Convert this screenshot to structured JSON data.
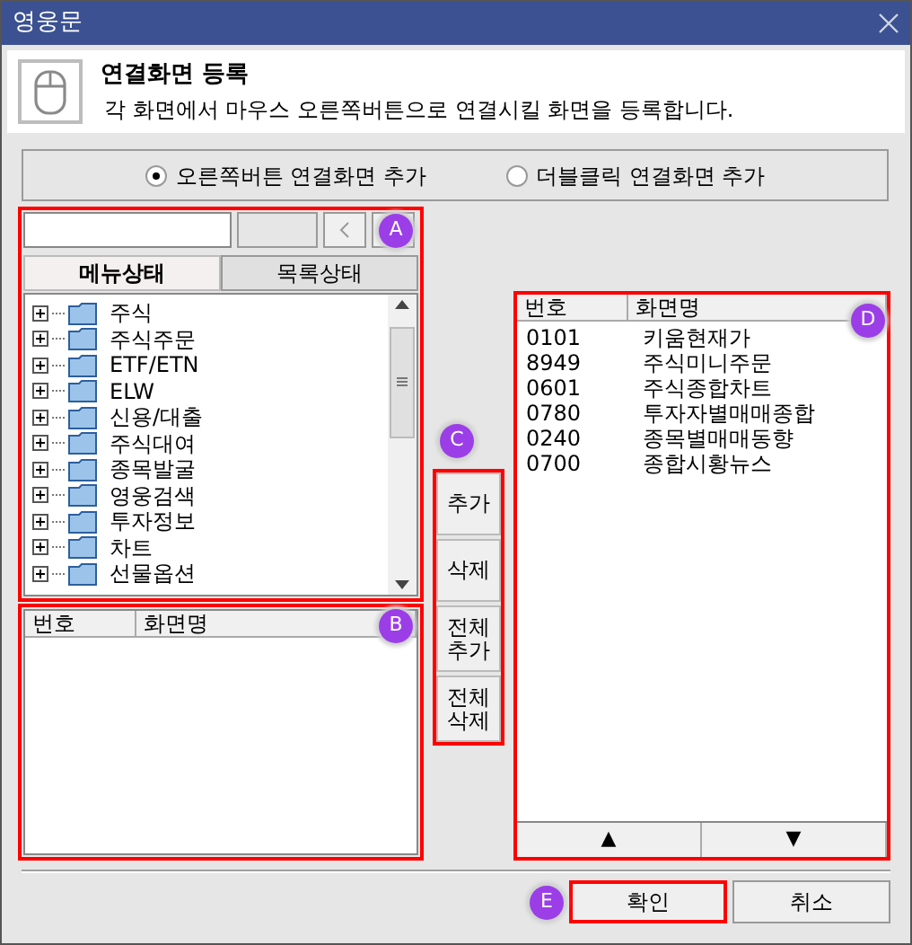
{
  "window": {
    "title": "영웅문"
  },
  "header": {
    "title": "연결화면 등록",
    "description": "각 화면에서 마우스 오른쪽버튼으로 연결시킬 화면을 등록합니다."
  },
  "radio_options": [
    {
      "label": "오른쪽버튼 연결화면 추가",
      "selected": true
    },
    {
      "label": "더블클릭 연결화면 추가",
      "selected": false
    }
  ],
  "tabs": [
    {
      "label": "메뉴상태",
      "selected": true
    },
    {
      "label": "목록상태",
      "selected": false
    }
  ],
  "tree": {
    "items": [
      {
        "label": "주식",
        "expanded": false
      },
      {
        "label": "주식주문",
        "expanded": false
      },
      {
        "label": "ETF/ETN",
        "expanded": false
      },
      {
        "label": "ELW",
        "expanded": false
      },
      {
        "label": "신용/대출",
        "expanded": false
      },
      {
        "label": "주식대여",
        "expanded": false
      },
      {
        "label": "종목발굴",
        "expanded": false
      },
      {
        "label": "영웅검색",
        "expanded": false
      },
      {
        "label": "투자정보",
        "expanded": false
      },
      {
        "label": "차트",
        "expanded": false
      },
      {
        "label": "선물옵션",
        "expanded": false
      }
    ]
  },
  "left_list": {
    "columns": [
      "번호",
      "화면명"
    ]
  },
  "action_buttons": [
    "추가",
    "삭제",
    "전체추가",
    "전체삭제"
  ],
  "right_list": {
    "columns": [
      "번호",
      "화면명"
    ],
    "rows": [
      {
        "number": "0101",
        "name": "키움현재가"
      },
      {
        "number": "8949",
        "name": "주식미니주문"
      },
      {
        "number": "0601",
        "name": "주식종합차트"
      },
      {
        "number": "0780",
        "name": "투자자별매매종합"
      },
      {
        "number": "0240",
        "name": "종목별매매동향"
      },
      {
        "number": "0700",
        "name": "종합시황뉴스"
      }
    ]
  },
  "move_buttons": [
    "▲",
    "▼"
  ],
  "footer_buttons": [
    "확인",
    "취소"
  ],
  "annotations": [
    "A",
    "B",
    "C",
    "D",
    "E"
  ]
}
